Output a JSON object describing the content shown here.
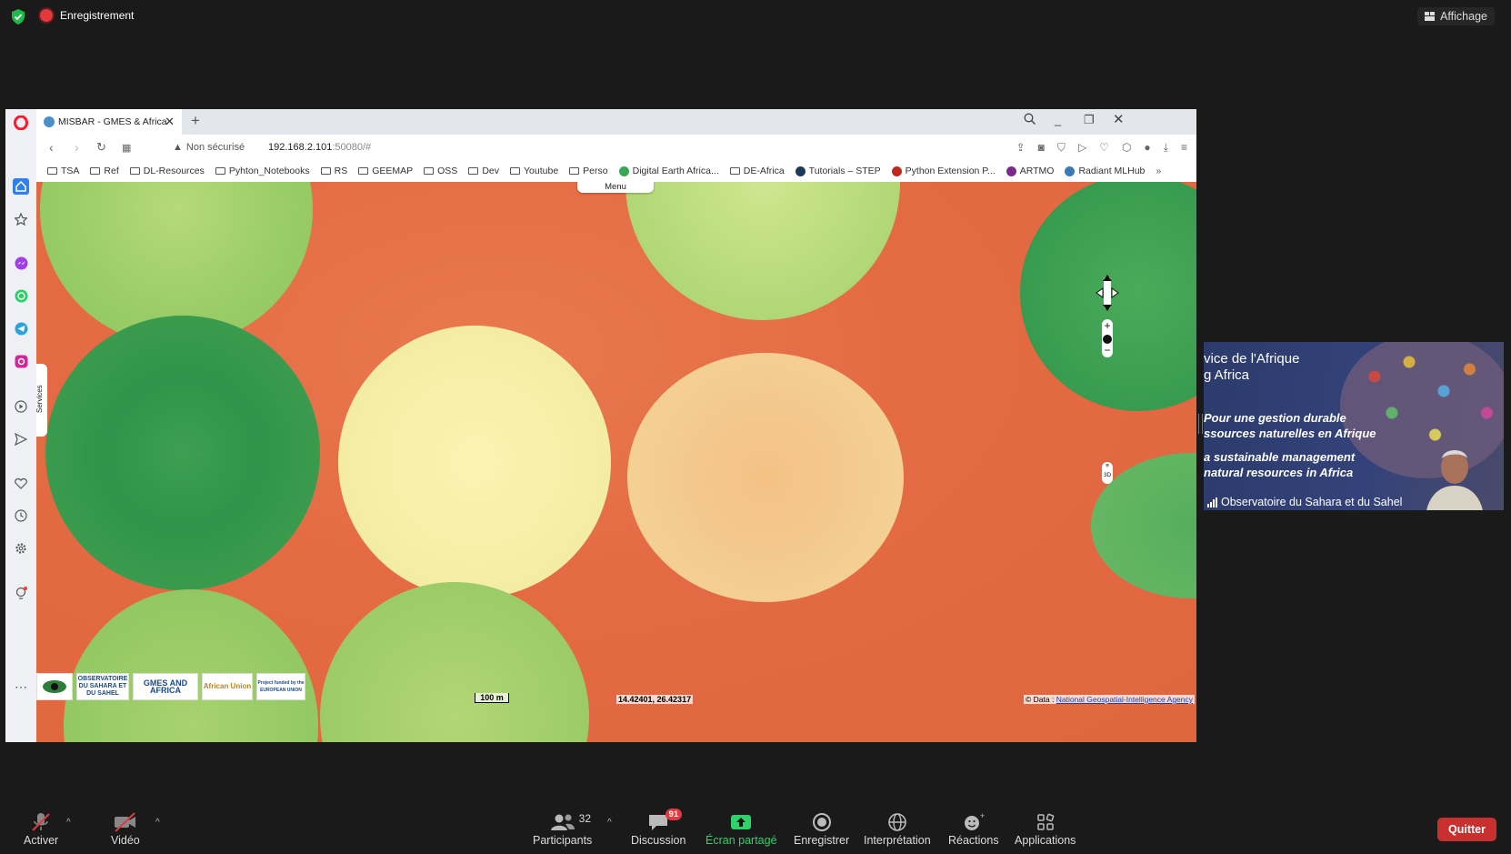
{
  "top": {
    "recording": "Enregistrement",
    "view": "Affichage"
  },
  "browser": {
    "tab_title": "MISBAR - GMES & Africa",
    "security": "Non sécurisé",
    "url_host": "192.168.2.101",
    "url_rest": ":50080/#",
    "bookmarks": [
      {
        "label": "TSA",
        "icon": "folder"
      },
      {
        "label": "Ref",
        "icon": "folder"
      },
      {
        "label": "DL-Resources",
        "icon": "folder"
      },
      {
        "label": "Pyhton_Notebooks",
        "icon": "folder"
      },
      {
        "label": "RS",
        "icon": "folder"
      },
      {
        "label": "GEEMAP",
        "icon": "folder"
      },
      {
        "label": "OSS",
        "icon": "folder"
      },
      {
        "label": "Dev",
        "icon": "folder"
      },
      {
        "label": "Youtube",
        "icon": "folder"
      },
      {
        "label": "Perso",
        "icon": "folder"
      },
      {
        "label": "Digital Earth Africa...",
        "icon": "drive",
        "color": "#34a853"
      },
      {
        "label": "DE-Africa",
        "icon": "folder"
      },
      {
        "label": "Tutorials – STEP",
        "icon": "site",
        "color": "#1b3a5a"
      },
      {
        "label": "Python Extension P...",
        "icon": "site",
        "color": "#c0281e"
      },
      {
        "label": "ARTMO",
        "icon": "site",
        "color": "#7a2a8a"
      },
      {
        "label": "Radiant MLHub",
        "icon": "site",
        "color": "#3a7ab8"
      }
    ]
  },
  "map": {
    "menu": "Menu",
    "services": "Services",
    "scale": "100 m",
    "coords": "14.42401, 26.42317",
    "attribution_prefix": "© Data :",
    "attribution_link": "National Geospatial-Intelligence Agency",
    "view_3d": "3D",
    "logos": [
      {
        "text": ""
      },
      {
        "text": "OBSERVATOIRE DU SAHARA ET DU SAHEL"
      },
      {
        "text": "GMES AND AFRICA"
      },
      {
        "text": "African Union"
      },
      {
        "text": "Project funded by the EUROPEAN UNION"
      }
    ]
  },
  "video": {
    "lines": [
      "vice de l'Afrique",
      "g Africa",
      "Pour une gestion durable",
      "ssources naturelles en Afrique",
      "a sustainable management",
      "natural resources in Africa"
    ],
    "participant_name": "Observatoire du Sahara et du Sahel"
  },
  "bottom": {
    "mute": "Activer",
    "video": "Vidéo",
    "participants": "Participants",
    "participant_count": "32",
    "chat": "Discussion",
    "chat_badge": "91",
    "share": "Écran partagé",
    "record": "Enregistrer",
    "interpretation": "Interprétation",
    "reactions": "Réactions",
    "apps": "Applications",
    "quit": "Quitter"
  },
  "colors": {
    "share_green": "#2fd16a",
    "quit_red": "#c7302f",
    "opera_red": "#ff1b2d"
  }
}
